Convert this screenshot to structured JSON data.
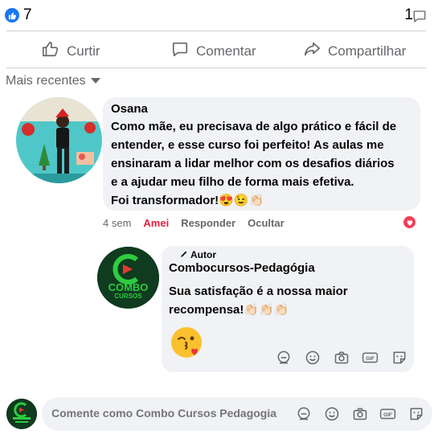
{
  "reactions": {
    "like_count": "7",
    "share_count": "1"
  },
  "actions": {
    "like": "Curtir",
    "comment": "Comentar",
    "share": "Compartilhar"
  },
  "sort": {
    "label": "Mais recentes"
  },
  "comment": {
    "author": "Osana",
    "lines": [
      "Como mãe, eu precisava de algo prático e fácil de",
      "entender, e esse curso foi perfeito! As aulas me",
      "ensinaram a lidar melhor com os desafios diários",
      "e a ajudar meu filho de forma mais efetiva.",
      "Foi transformador!😍😉👏🏻"
    ],
    "time": "4 sem",
    "reaction_label": "Amei",
    "reply_label": "Responder",
    "hide_label": "Ocultar"
  },
  "reply": {
    "badge": "Autor",
    "author": "Combocursos-Pedagógia",
    "lines": [
      "Sua satisfação é a nossa maior",
      "recompensa!👏🏻👏🏻👏🏻"
    ],
    "logo_text_1": "COMBO",
    "logo_text_2": "CURSOS"
  },
  "composer": {
    "placeholder": "Comente como Combo Cursos Pedagogia"
  },
  "colors": {
    "accent": "#1877f2",
    "love": "#e41e3f",
    "logo_green": "#2ecc40",
    "logo_red": "#e53935"
  }
}
